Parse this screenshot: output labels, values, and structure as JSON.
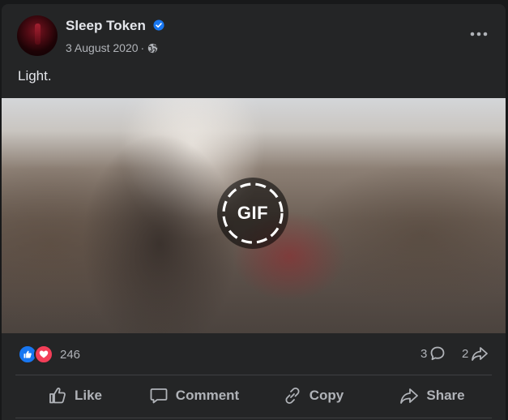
{
  "post": {
    "author": "Sleep Token",
    "date": "3 August 2020",
    "meta_separator": "·",
    "text": "Light.",
    "media_badge": "GIF",
    "reaction_count": "246",
    "comment_count": "3",
    "share_count": "2"
  },
  "icons": {
    "verified": "verified-badge-icon",
    "audience": "globe-icon",
    "more": "more-horizontal-icon",
    "reaction_like": "like-reaction-icon",
    "reaction_love": "love-reaction-icon",
    "comments": "comment-icon",
    "shares": "share-icon"
  },
  "actions": {
    "like": "Like",
    "comment": "Comment",
    "copy": "Copy",
    "share": "Share"
  },
  "colors": {
    "background": "#18191a",
    "card": "#242526",
    "text_primary": "#e4e6eb",
    "text_secondary": "#b0b3b8",
    "verified_blue": "#1877f2",
    "love_red": "#f33e58"
  }
}
